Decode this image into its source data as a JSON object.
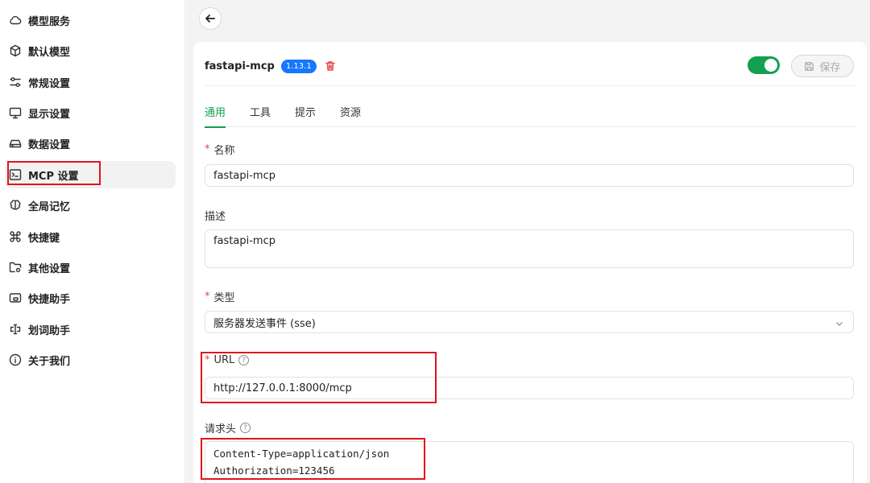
{
  "sidebar": {
    "items": [
      {
        "label": "模型服务",
        "icon": "cloud-icon"
      },
      {
        "label": "默认模型",
        "icon": "cube-icon"
      },
      {
        "label": "常规设置",
        "icon": "sliders-icon"
      },
      {
        "label": "显示设置",
        "icon": "monitor-icon"
      },
      {
        "label": "数据设置",
        "icon": "hard-drive-icon"
      },
      {
        "label": "MCP 设置",
        "icon": "terminal-icon"
      },
      {
        "label": "全局记忆",
        "icon": "brain-icon"
      },
      {
        "label": "快捷键",
        "icon": "command-icon"
      },
      {
        "label": "其他设置",
        "icon": "folder-gear-icon"
      },
      {
        "label": "快捷助手",
        "icon": "app-window-icon"
      },
      {
        "label": "划词助手",
        "icon": "text-cursor-icon"
      },
      {
        "label": "关于我们",
        "icon": "info-icon"
      }
    ],
    "active_index": 5
  },
  "header": {
    "server_name": "fastapi-mcp",
    "version": "1.13.1",
    "enabled": true,
    "save_label": "保存"
  },
  "tabs": [
    {
      "label": "通用",
      "active": true
    },
    {
      "label": "工具",
      "active": false
    },
    {
      "label": "提示",
      "active": false
    },
    {
      "label": "资源",
      "active": false
    }
  ],
  "form": {
    "name_label": "名称",
    "name_value": "fastapi-mcp",
    "desc_label": "描述",
    "desc_value": "fastapi-mcp",
    "type_label": "类型",
    "type_value": "服务器发送事件 (sse)",
    "url_label": "URL",
    "url_value": "http://127.0.0.1:8000/mcp",
    "headers_label": "请求头",
    "headers_line1": "Content-Type=application/json",
    "headers_line2": "Authorization=123456",
    "required_mark": "*",
    "help_mark": "?"
  },
  "colors": {
    "accent": "#12a150",
    "badge": "#1677ff",
    "highlight_box": "#e0141e",
    "danger": "#e5484d"
  }
}
